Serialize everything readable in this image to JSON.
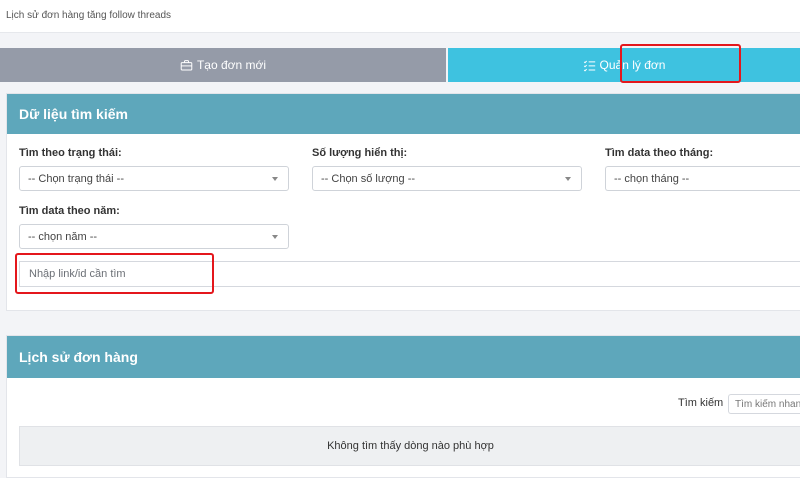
{
  "breadcrumb": "Lịch sử đơn hàng tăng follow threads",
  "tabs": {
    "new_order": "Tạo đơn mới",
    "manage": "Quản lý đơn"
  },
  "search_card": {
    "title": "Dữ liệu tìm kiếm",
    "status": {
      "label": "Tìm theo trạng thái:",
      "value": "-- Chọn trạng thái --"
    },
    "quantity": {
      "label": "Số lượng hiển thị:",
      "value": "-- Chọn số lượng --"
    },
    "month": {
      "label": "Tìm data theo tháng:",
      "value": "-- chọn tháng --"
    },
    "year": {
      "label": "Tìm data theo năm:",
      "value": "-- chọn năm --"
    },
    "link_placeholder": "Nhập link/id cần tìm"
  },
  "history_card": {
    "title": "Lịch sử đơn hàng",
    "search_label": "Tìm kiếm",
    "search_placeholder": "Tìm kiếm nhanh",
    "empty_message": "Không tìm thấy dòng nào phù hợp"
  },
  "colors": {
    "header": "#5ea7bb",
    "tab_active": "#3ec2e0",
    "tab_inactive": "#959ba8",
    "highlight": "#e4171c"
  }
}
